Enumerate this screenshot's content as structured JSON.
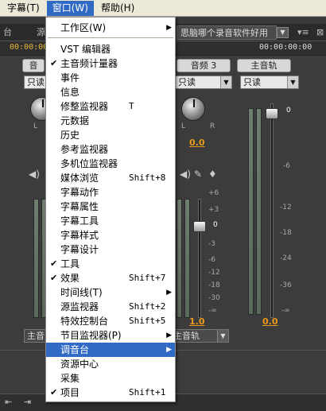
{
  "menubar": {
    "items": [
      {
        "label": "字幕(T)"
      },
      {
        "label": "窗口(W)"
      },
      {
        "label": "帮助(H)"
      }
    ]
  },
  "tabs": {
    "left": "台",
    "source": "源",
    "selected": "思脑哪个录音软件好用",
    "dropdown_arrow": "▼",
    "panel_menu": "▾≡",
    "close": "⊠"
  },
  "timecode": {
    "left": "00:00:00",
    "right": "00:00:00:00"
  },
  "mixer": {
    "track_left": "音",
    "track_audio3": "音频 3",
    "track_master": "主音轨",
    "mode_left": "只读",
    "mode_audio3": "只读",
    "mode_master": "只读",
    "knob_l": "L",
    "knob_r": "R",
    "pan_value": "0.0",
    "gain_value": "1.0",
    "master_fader_value": "0",
    "master_gain_value": "0.0",
    "audio3_fader_value": "0",
    "scale_left": [
      "+6",
      "+3",
      "0",
      "-3",
      "-6",
      "-12",
      "-18",
      "-30",
      "-∞"
    ],
    "scale_master": [
      "0",
      "-6",
      "-12",
      "-18",
      "-24",
      "-36",
      "-∞"
    ],
    "bus_left": "主音",
    "bus_audio3": "主音轨"
  },
  "menu": {
    "items": [
      {
        "label": "工作区(W)",
        "shortcut": "",
        "checked": false,
        "submenu": true
      },
      {
        "label": "VST 编辑器",
        "shortcut": "",
        "checked": false,
        "submenu": false
      },
      {
        "label": "主音频计量器",
        "shortcut": "",
        "checked": true,
        "submenu": false
      },
      {
        "label": "事件",
        "shortcut": "",
        "checked": false,
        "submenu": false
      },
      {
        "label": "信息",
        "shortcut": "",
        "checked": false,
        "submenu": false
      },
      {
        "label": "修整监视器",
        "shortcut": "T",
        "checked": false,
        "submenu": false
      },
      {
        "label": "元数据",
        "shortcut": "",
        "checked": false,
        "submenu": false
      },
      {
        "label": "历史",
        "shortcut": "",
        "checked": false,
        "submenu": false
      },
      {
        "label": "参考监视器",
        "shortcut": "",
        "checked": false,
        "submenu": false
      },
      {
        "label": "多机位监视器",
        "shortcut": "",
        "checked": false,
        "submenu": false
      },
      {
        "label": "媒体浏览",
        "shortcut": "Shift+8",
        "checked": false,
        "submenu": false
      },
      {
        "label": "字幕动作",
        "shortcut": "",
        "checked": false,
        "submenu": false
      },
      {
        "label": "字幕属性",
        "shortcut": "",
        "checked": false,
        "submenu": false
      },
      {
        "label": "字幕工具",
        "shortcut": "",
        "checked": false,
        "submenu": false
      },
      {
        "label": "字幕样式",
        "shortcut": "",
        "checked": false,
        "submenu": false
      },
      {
        "label": "字幕设计",
        "shortcut": "",
        "checked": false,
        "submenu": false
      },
      {
        "label": "工具",
        "shortcut": "",
        "checked": true,
        "submenu": false
      },
      {
        "label": "效果",
        "shortcut": "Shift+7",
        "checked": true,
        "submenu": false
      },
      {
        "label": "时间线(T)",
        "shortcut": "",
        "checked": false,
        "submenu": true
      },
      {
        "label": "源监视器",
        "shortcut": "Shift+2",
        "checked": false,
        "submenu": false
      },
      {
        "label": "特效控制台",
        "shortcut": "Shift+5",
        "checked": false,
        "submenu": false
      },
      {
        "label": "节目监视器(P)",
        "shortcut": "",
        "checked": false,
        "submenu": true
      },
      {
        "label": "调音台",
        "shortcut": "",
        "checked": false,
        "submenu": true
      },
      {
        "label": "资源中心",
        "shortcut": "",
        "checked": false,
        "submenu": false
      },
      {
        "label": "采集",
        "shortcut": "",
        "checked": false,
        "submenu": false
      },
      {
        "label": "项目",
        "shortcut": "Shift+1",
        "checked": true,
        "submenu": false
      }
    ],
    "check_glyph": "✔",
    "submenu_glyph": "▶"
  },
  "colors": {
    "highlight": "#316ac5",
    "menubar_bg": "#ece9d8",
    "accent_orange": "#e89a1c",
    "timecode_yellow": "#e8b53a",
    "dark_bg": "#3c3c3c"
  }
}
